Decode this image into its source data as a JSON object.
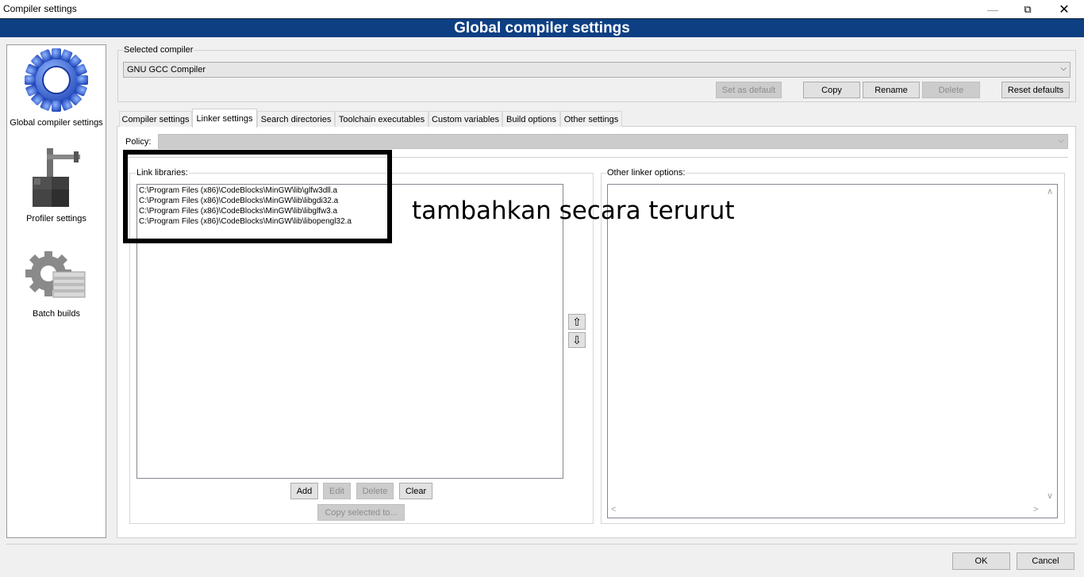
{
  "window": {
    "title": "Compiler settings",
    "minimize": "—",
    "maximize": "⧉",
    "close": "✕"
  },
  "banner": {
    "title": "Global compiler settings"
  },
  "left_panel": {
    "items": [
      {
        "label": "Global compiler settings",
        "icon": "gear-icon",
        "selected": true
      },
      {
        "label": "Profiler settings",
        "icon": "caliper-icon",
        "selected": false
      },
      {
        "label": "Batch builds",
        "icon": "gear-stack-icon",
        "selected": false
      }
    ]
  },
  "selected_compiler": {
    "label": "Selected compiler",
    "value": "GNU GCC Compiler",
    "buttons": {
      "set_default": "Set as default",
      "copy": "Copy",
      "rename": "Rename",
      "delete": "Delete",
      "reset": "Reset defaults"
    }
  },
  "tabs": [
    {
      "label": "Compiler settings",
      "active": false
    },
    {
      "label": "Linker settings",
      "active": true
    },
    {
      "label": "Search directories",
      "active": false
    },
    {
      "label": "Toolchain executables",
      "active": false
    },
    {
      "label": "Custom variables",
      "active": false
    },
    {
      "label": "Build options",
      "active": false
    },
    {
      "label": "Other settings",
      "active": false
    }
  ],
  "policy": {
    "label": "Policy:",
    "value": ""
  },
  "link_libraries": {
    "label": "Link libraries:",
    "items": [
      "C:\\Program Files (x86)\\CodeBlocks\\MinGW\\lib\\glfw3dll.a",
      "C:\\Program Files (x86)\\CodeBlocks\\MinGW\\lib\\libgdi32.a",
      "C:\\Program Files (x86)\\CodeBlocks\\MinGW\\lib\\libglfw3.a",
      "C:\\Program Files (x86)\\CodeBlocks\\MinGW\\lib\\libopengl32.a"
    ],
    "buttons": {
      "add": "Add",
      "edit": "Edit",
      "delete": "Delete",
      "clear": "Clear",
      "copy_to": "Copy selected to..."
    }
  },
  "move_buttons": {
    "up": "⇧",
    "down": "⇩"
  },
  "other_linker": {
    "label": "Other linker options:",
    "value": ""
  },
  "annotation": {
    "text": "tambahkan secara terurut"
  },
  "dialog_buttons": {
    "ok": "OK",
    "cancel": "Cancel"
  },
  "colors": {
    "banner": "#0e3f83",
    "annotation_box": "#000000"
  }
}
